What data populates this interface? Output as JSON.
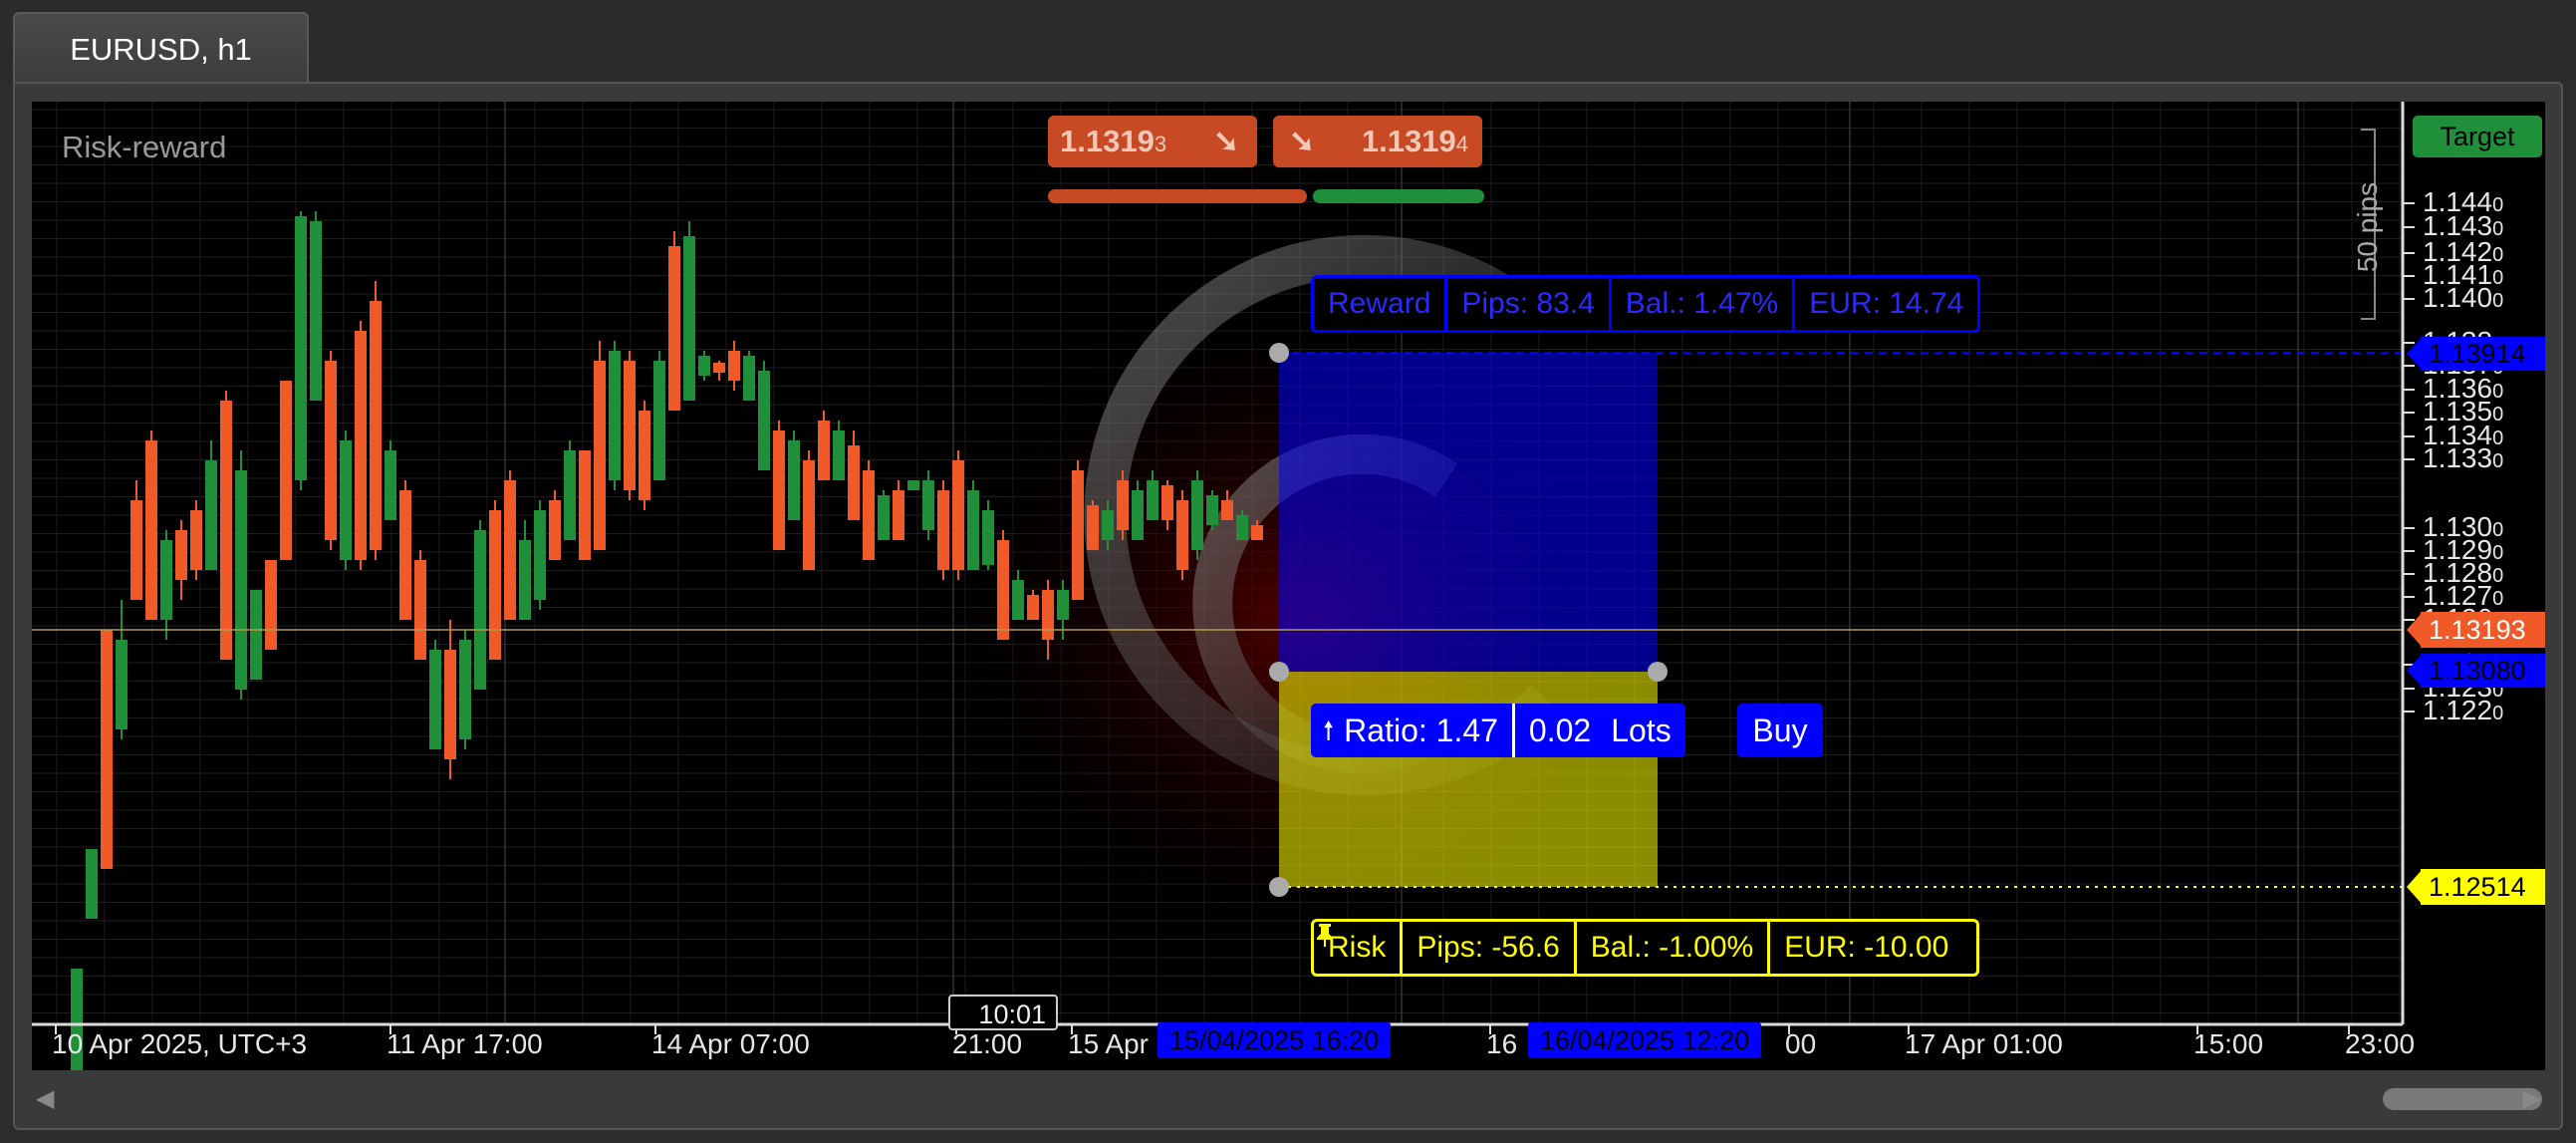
{
  "tab": {
    "title": "EURUSD, h1"
  },
  "chart": {
    "watermark": "Risk-reward",
    "sell_price_main": "1.1319",
    "sell_price_sub": "3",
    "buy_price_main": "1.1319",
    "buy_price_sub": "4",
    "arrow_down": "➘",
    "pips_ruler": "50 pips",
    "target_badge": "Target",
    "colors": {
      "bull": "#1f8f3a",
      "bear": "#f05a28",
      "reward": "#0000ff",
      "risk": "#ffff00",
      "current": "#f05a28",
      "sell_box": "#c84a24",
      "buy_box": "#c84a24"
    }
  },
  "reward_panel": {
    "label": "Reward",
    "pips": "Pips: 83.4",
    "balance": "Bal.: 1.47%",
    "eur": "EUR: 14.74"
  },
  "risk_panel": {
    "label": "Risk",
    "pips": "Pips: -56.6",
    "balance": "Bal.: -1.00%",
    "eur": "EUR: -10.00"
  },
  "order": {
    "arrow": "🠕",
    "ratio": "Ratio: 1.47",
    "lots_value": "0.02",
    "lots_label": "Lots",
    "buy": "Buy"
  },
  "price_axis": {
    "ticks": [
      "1.1440",
      "1.1430",
      "1.1420",
      "1.1410",
      "1.1400",
      "1.1380",
      "1.1370",
      "1.1360",
      "1.1350",
      "1.1340",
      "1.1330",
      "1.1300",
      "1.1290",
      "1.1280",
      "1.1270",
      "1.1260",
      "1.1240",
      "1.1230",
      "1.1220"
    ],
    "target_level": "1.13914",
    "current_price": "1.13193",
    "entry_level": "1.13080",
    "stop_level": "1.12514"
  },
  "time_axis": {
    "labels": [
      "10 Apr 2025, UTC+3",
      "11 Apr 17:00",
      "14 Apr 07:00",
      "21:00",
      "15 Apr",
      "16",
      "00",
      "17 Apr 01:00",
      "15:00",
      "23:00"
    ],
    "crosshair_time": "10:01",
    "start_marker": "15/04/2025 16:20",
    "end_marker": "16/04/2025 12:20"
  }
}
